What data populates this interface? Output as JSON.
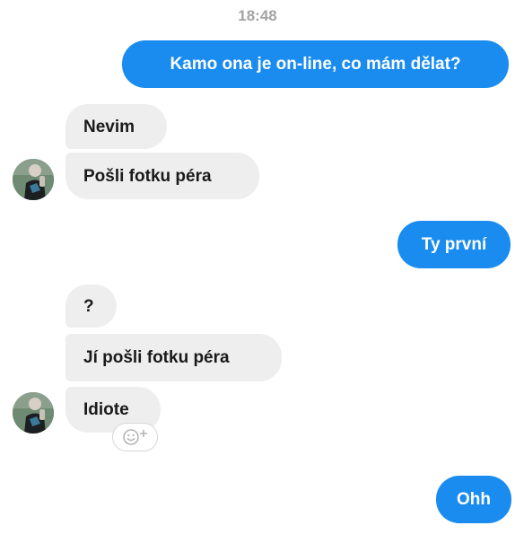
{
  "header": {
    "time": "18:48"
  },
  "messages": [
    {
      "text": "Kamo ona je on-line, co mám dělat?"
    },
    {
      "text": "Nevim"
    },
    {
      "text": "Pošli fotku péra"
    },
    {
      "text": "Ty první"
    },
    {
      "text": "?"
    },
    {
      "text": "Jí pošli fotku péra"
    },
    {
      "text": "Idiote"
    },
    {
      "text": "Ohh"
    }
  ],
  "colors": {
    "outgoing_bubble": "#1a8cf0",
    "incoming_bubble": "#eeeeee",
    "timestamp": "#a3a3a3"
  },
  "icons": [
    "avatar",
    "add-reaction-icon"
  ]
}
